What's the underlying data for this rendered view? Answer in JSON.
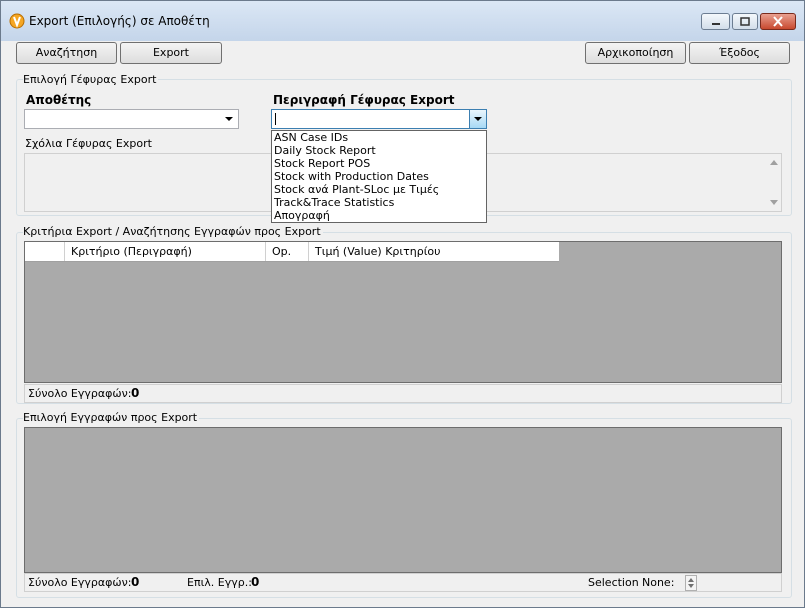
{
  "window": {
    "title": "Export (Επιλογής) σε Αποθέτη"
  },
  "toolbar": {
    "search_label": "Αναζήτηση",
    "export_label": "Export",
    "reset_label": "Αρχικοποίηση",
    "exit_label": "Έξοδος"
  },
  "bridge_group": {
    "title": "Επιλογή Γέφυρας Export",
    "depositor_label": "Αποθέτης",
    "depositor_value": "",
    "description_label": "Περιγραφή Γέφυρας Export",
    "description_value": "",
    "comments_label": "Σχόλια Γέφυρας Export",
    "dropdown_options": [
      "ASN Case IDs",
      "Daily Stock Report",
      "Stock Report POS",
      "Stock with Production Dates",
      "Stock ανά Plant-SLoc με Τιμές",
      "Track&Trace Statistics",
      "Απογραφή"
    ]
  },
  "criteria_group": {
    "title": "Κριτήρια Export / Αναζήτησης Εγγραφών προς Export",
    "columns": [
      "",
      "Κριτήριο (Περιγραφή)",
      "Op.",
      "Τιμή (Value) Κριτηρίου"
    ],
    "total_label": "Σύνολο Εγγραφών:",
    "total_value": "0"
  },
  "records_group": {
    "title": "Επιλογή Εγγραφών προς Export",
    "total_label": "Σύνολο Εγγραφών:",
    "total_value": "0",
    "selected_label": "Επιλ. Εγγρ.:",
    "selected_value": "0",
    "selection_label": "Selection",
    "selection_value": "None:"
  },
  "colors": {
    "grid_background": "#aaaaaa",
    "window_background": "#f0f0f0",
    "titlebar": "#c4d5ea"
  }
}
